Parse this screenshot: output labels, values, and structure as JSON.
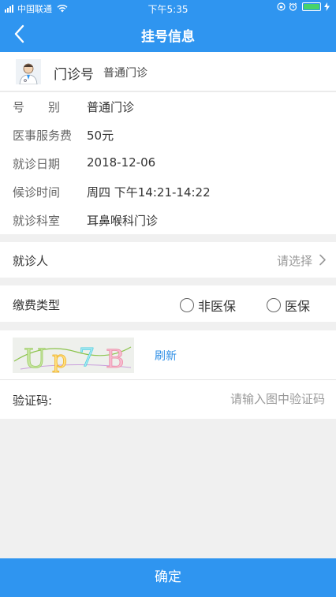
{
  "status_bar": {
    "carrier": "中国联通",
    "time": "下午5:35"
  },
  "nav": {
    "title": "挂号信息"
  },
  "clinic": {
    "number_label": "门诊号",
    "type": "普通门诊"
  },
  "details": [
    {
      "label": "号　　别",
      "value": "普通门诊"
    },
    {
      "label": "医事服务费",
      "value": "50元"
    },
    {
      "label": "就诊日期",
      "value": "2018-12-06"
    },
    {
      "label": "候诊时间",
      "value": "周四 下午14:21-14:22"
    },
    {
      "label": "就诊科室",
      "value": "耳鼻喉科门诊"
    }
  ],
  "patient": {
    "label": "就诊人",
    "placeholder": "请选择"
  },
  "payment": {
    "label": "缴费类型",
    "options": [
      "非医保",
      "医保"
    ]
  },
  "captcha": {
    "code": "Up7B",
    "refresh_label": "刷新",
    "input_label": "验证码:",
    "input_placeholder": "请输入图中验证码"
  },
  "confirm_label": "确定",
  "colors": {
    "primary": "#2f95f0",
    "link": "#2f8fe6",
    "battery": "#46d36a"
  }
}
